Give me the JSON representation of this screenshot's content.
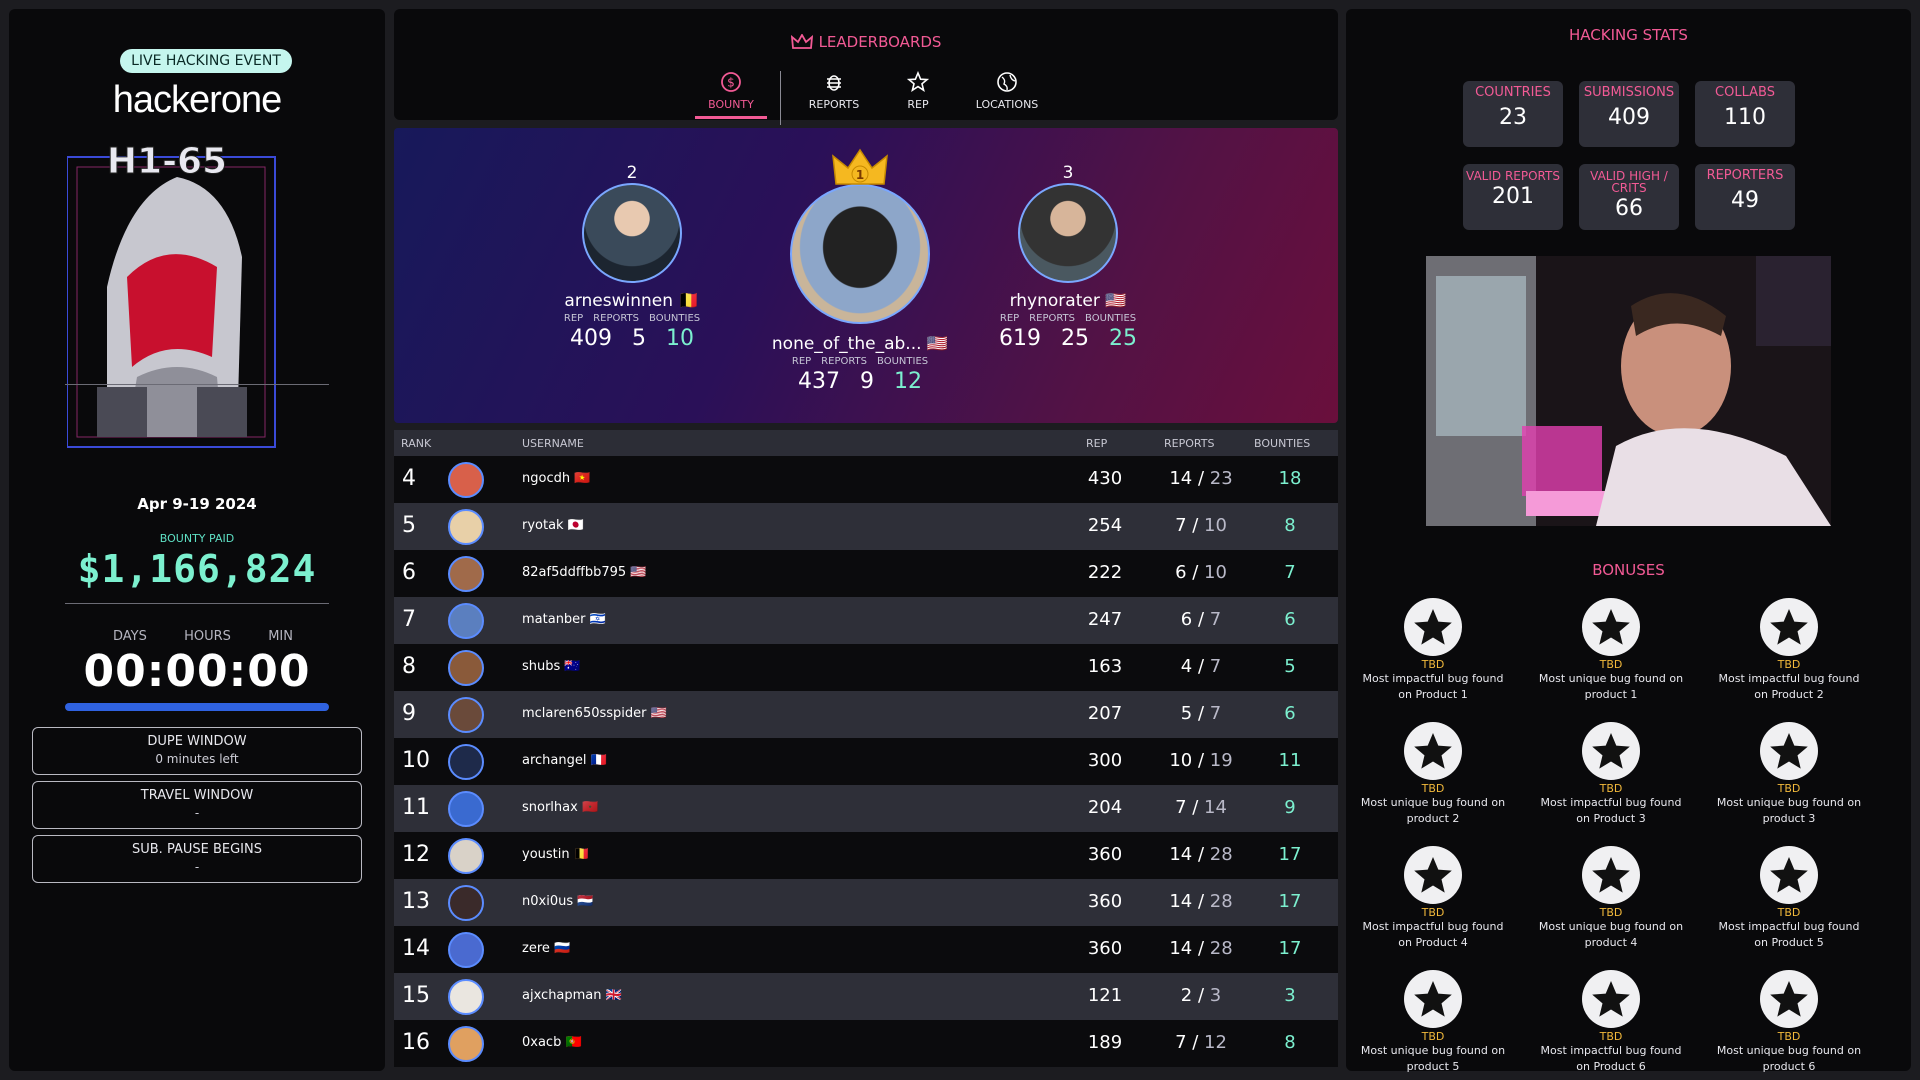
{
  "left": {
    "badge": "LIVE HACKING EVENT",
    "brand": "hackerone",
    "event_logo_text": "H1-65",
    "dates": "Apr 9-19 2024",
    "bounty_paid_label": "BOUNTY PAID",
    "bounty_paid_value": "$1,166,824",
    "timer_labels": [
      "DAYS",
      "HOURS",
      "MIN"
    ],
    "timer": "00:00:00",
    "progress": 1.0,
    "boxes": [
      {
        "title": "DUPE WINDOW",
        "value": "0 minutes left"
      },
      {
        "title": "TRAVEL WINDOW",
        "value": "-"
      },
      {
        "title": "SUB. PAUSE BEGINS",
        "value": "-"
      }
    ]
  },
  "leaderboard": {
    "title": "LEADERBOARDS",
    "tabs": [
      {
        "label": "BOUNTY",
        "icon": "dollar-circle-icon",
        "active": true
      },
      {
        "label": "REPORTS",
        "icon": "bug-icon",
        "active": false
      },
      {
        "label": "REP",
        "icon": "star-outline-icon",
        "active": false
      },
      {
        "label": "LOCATIONS",
        "icon": "globe-icon",
        "active": false
      }
    ],
    "stat_labels": [
      "REP",
      "REPORTS",
      "BOUNTIES"
    ],
    "podium": [
      {
        "rank": "2",
        "name": "arneswinnen",
        "flag": "🇧🇪",
        "rep": "409",
        "reports": "5",
        "bounties": "10"
      },
      {
        "rank": "1",
        "name": "none_of_the_ab...",
        "flag": "🇺🇸",
        "rep": "437",
        "reports": "9",
        "bounties": "12"
      },
      {
        "rank": "3",
        "name": "rhynorater",
        "flag": "🇺🇸",
        "rep": "619",
        "reports": "25",
        "bounties": "25"
      }
    ],
    "columns": {
      "rank": "RANK",
      "username": "USERNAME",
      "rep": "REP",
      "reports": "REPORTS",
      "bounties": "BOUNTIES"
    },
    "rows": [
      {
        "rank": "4",
        "user": "ngocdh",
        "flag": "🇻🇳",
        "rep": "430",
        "valid": "14",
        "total": "23",
        "bounties": "18"
      },
      {
        "rank": "5",
        "user": "ryotak",
        "flag": "🇯🇵",
        "rep": "254",
        "valid": "7",
        "total": "10",
        "bounties": "8"
      },
      {
        "rank": "6",
        "user": "82af5ddffbb795",
        "flag": "🇺🇸",
        "rep": "222",
        "valid": "6",
        "total": "10",
        "bounties": "7"
      },
      {
        "rank": "7",
        "user": "matanber",
        "flag": "🇮🇱",
        "rep": "247",
        "valid": "6",
        "total": "7",
        "bounties": "6"
      },
      {
        "rank": "8",
        "user": "shubs",
        "flag": "🇦🇺",
        "rep": "163",
        "valid": "4",
        "total": "7",
        "bounties": "5"
      },
      {
        "rank": "9",
        "user": "mclaren650sspider",
        "flag": "🇺🇸",
        "rep": "207",
        "valid": "5",
        "total": "7",
        "bounties": "6"
      },
      {
        "rank": "10",
        "user": "archangel",
        "flag": "🇫🇷",
        "rep": "300",
        "valid": "10",
        "total": "19",
        "bounties": "11"
      },
      {
        "rank": "11",
        "user": "snorlhax",
        "flag": "🇲🇦",
        "rep": "204",
        "valid": "7",
        "total": "14",
        "bounties": "9"
      },
      {
        "rank": "12",
        "user": "youstin",
        "flag": "🇧🇪",
        "rep": "360",
        "valid": "14",
        "total": "28",
        "bounties": "17"
      },
      {
        "rank": "13",
        "user": "n0xi0us",
        "flag": "🇳🇱",
        "rep": "360",
        "valid": "14",
        "total": "28",
        "bounties": "17"
      },
      {
        "rank": "14",
        "user": "zere",
        "flag": "🇷🇺",
        "rep": "360",
        "valid": "14",
        "total": "28",
        "bounties": "17"
      },
      {
        "rank": "15",
        "user": "ajxchapman",
        "flag": "🇬🇧",
        "rep": "121",
        "valid": "2",
        "total": "3",
        "bounties": "3"
      },
      {
        "rank": "16",
        "user": "0xacb",
        "flag": "🇵🇹",
        "rep": "189",
        "valid": "7",
        "total": "12",
        "bounties": "8"
      }
    ]
  },
  "stats": {
    "title": "HACKING STATS",
    "items": [
      {
        "label": "COUNTRIES",
        "value": "23"
      },
      {
        "label": "SUBMISSIONS",
        "value": "409"
      },
      {
        "label": "COLLABS",
        "value": "110"
      },
      {
        "label": "VALID REPORTS",
        "value": "201"
      },
      {
        "label": "VALID HIGH / CRITS",
        "value": "66"
      },
      {
        "label": "REPORTERS",
        "value": "49"
      }
    ]
  },
  "bonuses": {
    "title": "BONUSES",
    "items": [
      {
        "status": "TBD",
        "desc": "Most impactful bug found on Product 1"
      },
      {
        "status": "TBD",
        "desc": "Most unique bug found on product 1"
      },
      {
        "status": "TBD",
        "desc": "Most impactful bug found on Product 2"
      },
      {
        "status": "TBD",
        "desc": "Most unique bug found on product 2"
      },
      {
        "status": "TBD",
        "desc": "Most impactful bug found on Product 3"
      },
      {
        "status": "TBD",
        "desc": "Most unique bug found on product 3"
      },
      {
        "status": "TBD",
        "desc": "Most impactful bug found on Product 4"
      },
      {
        "status": "TBD",
        "desc": "Most unique bug found on product 4"
      },
      {
        "status": "TBD",
        "desc": "Most impactful bug found on Product 5"
      },
      {
        "status": "TBD",
        "desc": "Most unique bug found on product 5"
      },
      {
        "status": "TBD",
        "desc": "Most impactful bug found on Product 6"
      },
      {
        "status": "TBD",
        "desc": "Most unique bug found on product 6"
      }
    ]
  },
  "colors": {
    "accent": "#f25a95",
    "teal": "#7cf0cf",
    "blue": "#2f62e0",
    "gold": "#f2b93b"
  }
}
